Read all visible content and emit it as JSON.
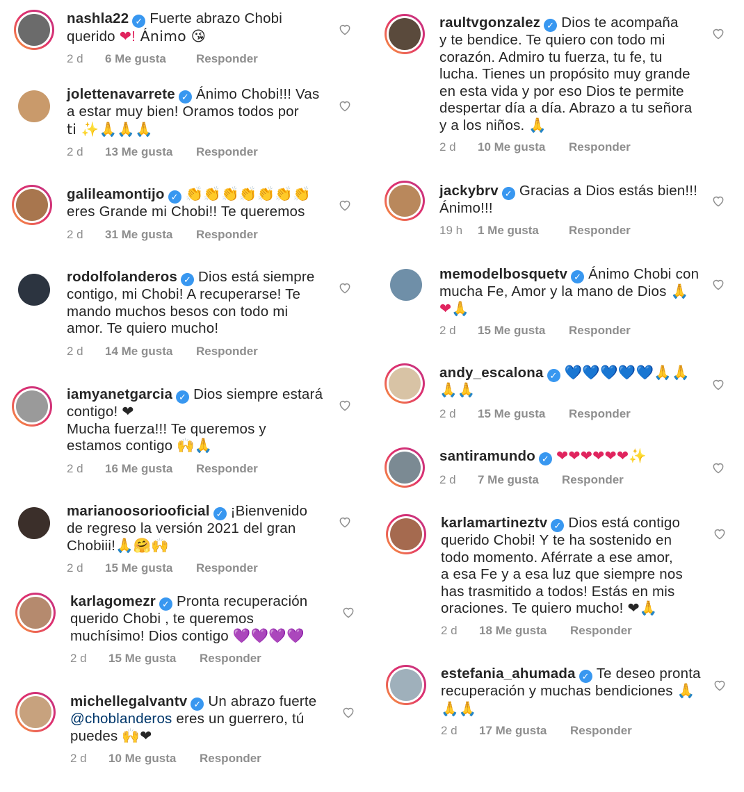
{
  "comments_left": [
    {
      "username": "nashla22",
      "line1": "Fuerte abrazo Chobi",
      "line2": "querido ",
      "emoji_line2": "❤!",
      "text_after": " Ánimo 😘",
      "time": "2 d",
      "likes": "6 Me gusta",
      "reply": "Responder"
    },
    {
      "username": "jolettenavarrete",
      "line1": "Ánimo Chobi!!! Vas",
      "line2": "a estar muy bien! Oramos todos por",
      "line3": "ti ✨🙏🙏🙏",
      "time": "2 d",
      "likes": "13 Me gusta",
      "reply": "Responder"
    },
    {
      "username": "galileamontijo",
      "line1": "👏👏👏👏👏👏👏",
      "line2": "eres Grande mi Chobi!! Te queremos",
      "time": "2 d",
      "likes": "31 Me gusta",
      "reply": "Responder"
    },
    {
      "username": "rodolfolanderos",
      "line1": "Dios está siempre",
      "line2": "contigo, mi Chobi! A recuperarse! Te",
      "line3": "mando muchos besos con todo mi",
      "line4": "amor. Te quiero mucho!",
      "time": "2 d",
      "likes": "14 Me gusta",
      "reply": "Responder"
    },
    {
      "username": "iamyanetgarcia",
      "line1": "Dios siempre estará",
      "line2": "contigo! ❤",
      "line3": "Mucha fuerza!!! Te queremos y",
      "line4": "estamos contigo 🙌🙏",
      "time": "2 d",
      "likes": "16 Me gusta",
      "reply": "Responder"
    },
    {
      "username": "marianoosoriooficial",
      "line1": "¡Bienvenido",
      "line2": "de regreso la versión 2021 del gran",
      "line3": "Chobiii!🙏🤗🙌",
      "time": "2 d",
      "likes": "15 Me gusta",
      "reply": "Responder"
    },
    {
      "username": "karlagomezr",
      "line1": "Pronta recuperación",
      "line2": "querido Chobi , te queremos",
      "line3": "muchísimo! Dios contigo 💜💜💜💜",
      "time": "2 d",
      "likes": "15 Me gusta",
      "reply": "Responder"
    },
    {
      "username": "michellegalvantv",
      "line1": "Un abrazo fuerte",
      "mention": "@choblanderos",
      "line2_rest": " eres un guerrero, tú",
      "line3": "puedes 🙌❤",
      "time": "2 d",
      "likes": "10 Me gusta",
      "reply": "Responder"
    }
  ],
  "comments_right": [
    {
      "username": "raultvgonzalez",
      "line1": "Dios te acompaña",
      "line2": "y te bendice. Te quiero con todo mi",
      "line3": "corazón. Admiro tu fuerza, tu fe, tu",
      "line4": "lucha. Tienes un propósito muy grande",
      "line5": "en esta vida y por eso Dios te permite",
      "line6": "despertar día a día. Abrazo a tu señora",
      "line7": "y a los niños. 🙏",
      "time": "2 d",
      "likes": "10 Me gusta",
      "reply": "Responder"
    },
    {
      "username": "jackybrv",
      "line1": "Gracias a Dios estás bien!!!",
      "line2": "Ánimo!!!",
      "time": "19 h",
      "likes": "1 Me gusta",
      "reply": "Responder"
    },
    {
      "username": "memodelbosquetv",
      "line1": "Ánimo Chobi con",
      "line2": "mucha Fe, Amor y la mano de Dios 🙏",
      "line3": "❤🙏",
      "time": "2 d",
      "likes": "15 Me gusta",
      "reply": "Responder"
    },
    {
      "username": "andy_escalona",
      "line1": "💙💙💙💙💙🙏🙏",
      "line2": "🙏🙏",
      "time": "2 d",
      "likes": "15 Me gusta",
      "reply": "Responder"
    },
    {
      "username": "santiramundo",
      "line1": "❤❤❤❤❤❤✨",
      "time": "2 d",
      "likes": "7 Me gusta",
      "reply": "Responder"
    },
    {
      "username": "karlamartineztv",
      "line1": "Dios está contigo",
      "line2": "querido Chobi! Y te ha sostenido en",
      "line3": "todo momento. Aférrate a ese amor,",
      "line4": "a esa Fe y a esa luz que siempre nos",
      "line5": "has trasmitido a todos! Estás en mis",
      "line6": "oraciones. Te quiero mucho! ❤🙏",
      "time": "2 d",
      "likes": "18 Me gusta",
      "reply": "Responder"
    },
    {
      "username": "estefania_ahumada",
      "line1": "Te deseo pronta",
      "line2": "recuperación y muchas bendiciones 🙏",
      "line3": "🙏🙏",
      "time": "2 d",
      "likes": "17 Me gusta",
      "reply": "Responder"
    }
  ],
  "colors": {
    "verified": "#3897f0",
    "meta_text": "#8e8e8e",
    "mention": "#00376b"
  },
  "icons": {
    "verified": "verified-badge-icon",
    "like": "heart-outline-icon"
  }
}
